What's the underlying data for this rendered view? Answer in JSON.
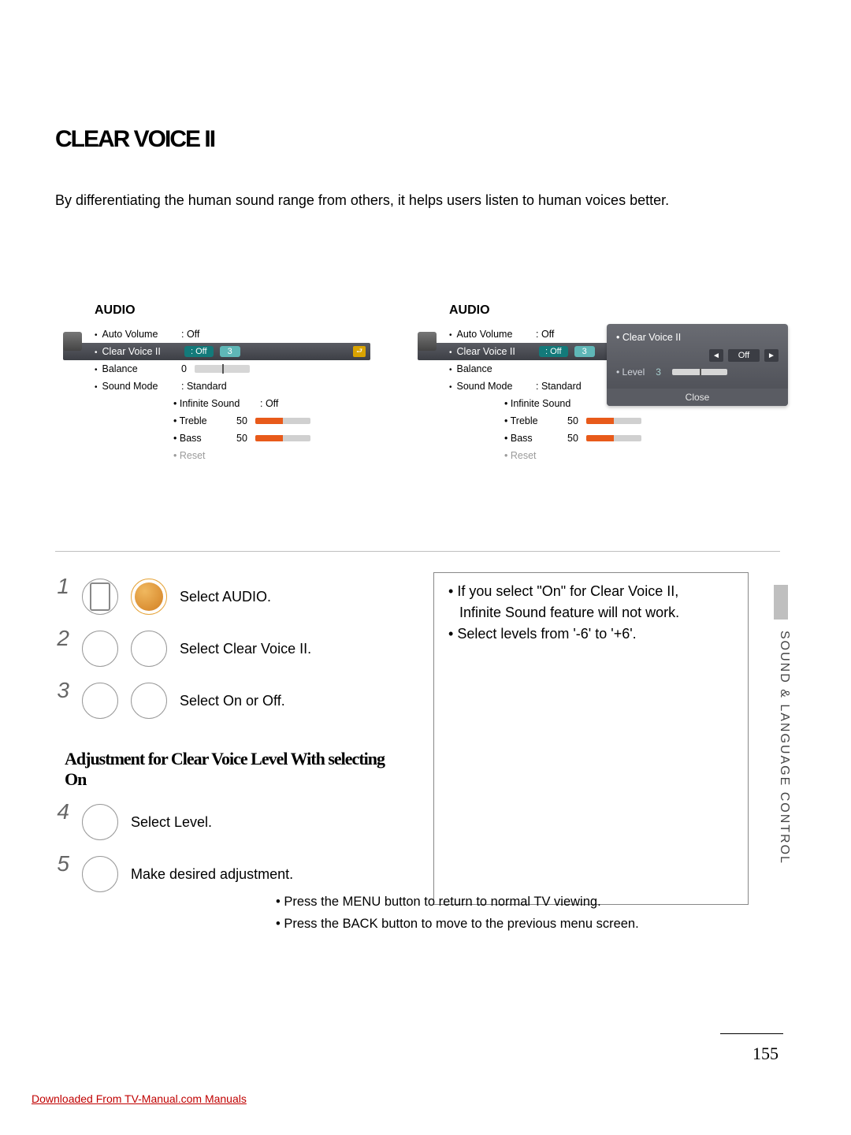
{
  "title": "CLEAR VOICE  II",
  "intro": "By differentiating the human sound range from others, it helps users listen to human voices better.",
  "osd": {
    "heading": "AUDIO",
    "items": {
      "auto_volume": {
        "label": "Auto Volume",
        "value": ": Off"
      },
      "clear_voice": {
        "label": "Clear Voice II",
        "value": "Off",
        "num": "3"
      },
      "balance": {
        "label": "Balance",
        "value": "0"
      },
      "sound_mode": {
        "label": "Sound Mode",
        "value": ": Standard"
      },
      "infinite_sound": {
        "label": "Infinite Sound",
        "value": ": Off"
      },
      "treble": {
        "label": "Treble",
        "value": "50"
      },
      "bass": {
        "label": "Bass",
        "value": "50"
      },
      "reset": {
        "label": "Reset"
      }
    }
  },
  "popup": {
    "title": "Clear Voice II",
    "off": "Off",
    "level_label": "Level",
    "level_value": "3",
    "close": "Close"
  },
  "steps": {
    "s1": "Select AUDIO.",
    "s2": "Select Clear Voice II.",
    "s3": "Select On or Off.",
    "sub_heading": "Adjustment for Clear Voice Level With selecting On",
    "s4": "Select Level.",
    "s5": "Make desired adjustment."
  },
  "note": {
    "line1a": "If you select \"On\" for Clear Voice II,",
    "line1b": "Infinite Sound feature will not work.",
    "line2": "Select levels from '-6' to '+6'."
  },
  "sidebar": "SOUND & LANGUAGE CONTROL",
  "footer": {
    "line1": "Press the MENU button to return to normal TV viewing.",
    "line2": "Press the BACK        button to move to the previous menu screen."
  },
  "page_number": "155",
  "download_link": "Downloaded From TV-Manual.com Manuals"
}
